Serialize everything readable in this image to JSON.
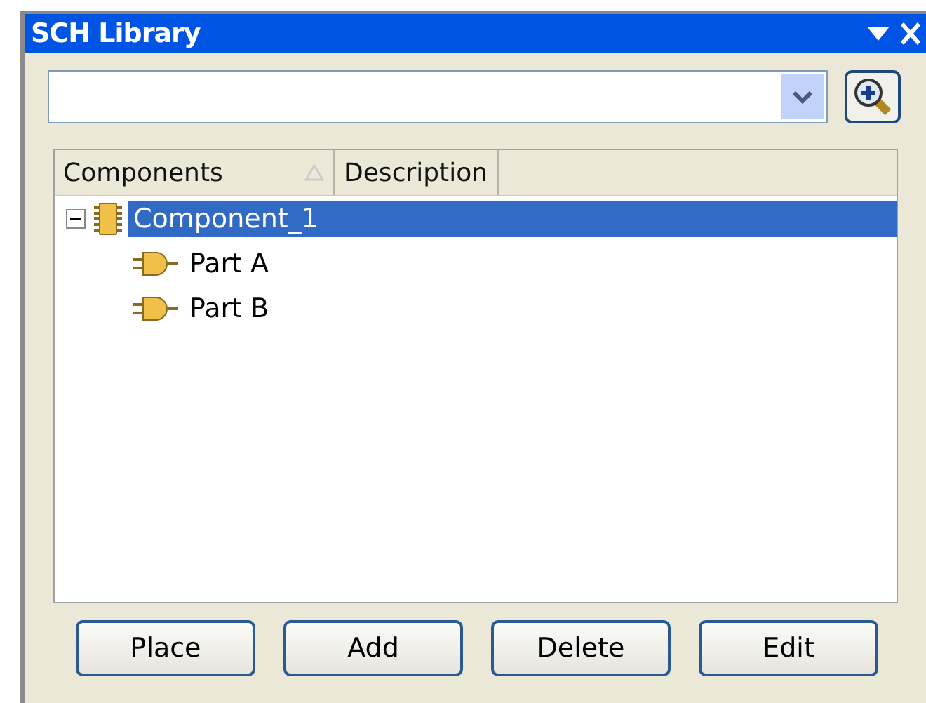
{
  "window": {
    "title": "SCH Library"
  },
  "table": {
    "columns": [
      {
        "label": "Components",
        "sorted": true
      },
      {
        "label": "Description",
        "sorted": false
      }
    ],
    "tree": [
      {
        "label": "Component_1",
        "kind": "component",
        "expanded": true,
        "selected": true,
        "children": [
          {
            "label": "Part A",
            "kind": "part",
            "selected": false
          },
          {
            "label": "Part B",
            "kind": "part",
            "selected": false
          }
        ]
      }
    ]
  },
  "buttons": [
    "Place",
    "Add",
    "Delete",
    "Edit"
  ]
}
